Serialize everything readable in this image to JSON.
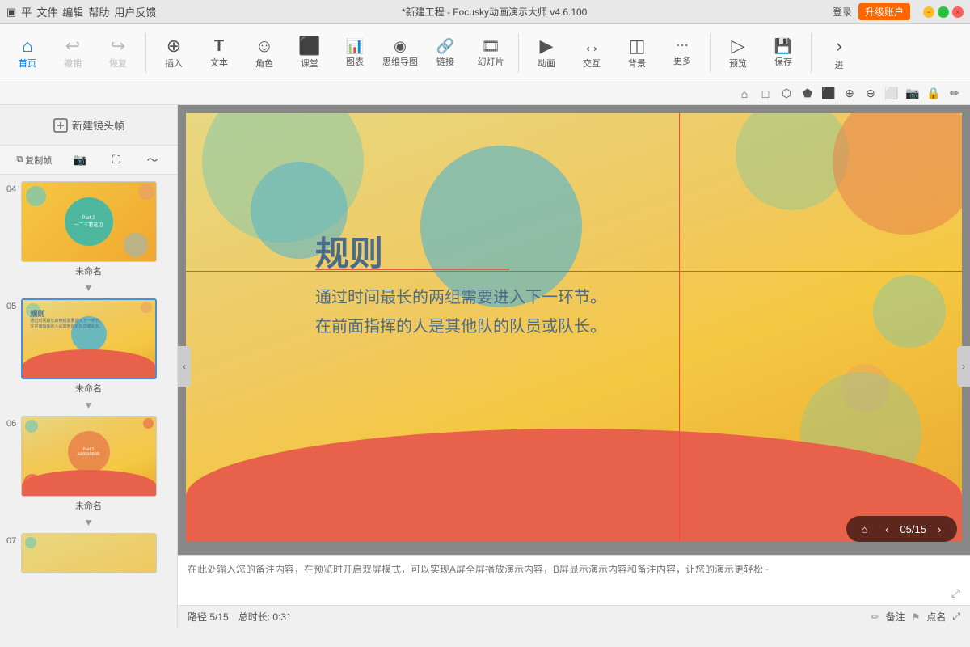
{
  "titlebar": {
    "app_icon": "▣",
    "menu_items": [
      "平",
      "文件",
      "编辑",
      "帮助",
      "用户反馈"
    ],
    "title": "*新建工程 - Focusky动画演示大师  v4.6.100",
    "login_label": "登录",
    "upgrade_label": "升级账户"
  },
  "toolbar": {
    "items": [
      {
        "id": "home",
        "icon": "⌂",
        "label": "首页"
      },
      {
        "id": "undo",
        "icon": "↩",
        "label": "撤销"
      },
      {
        "id": "redo",
        "icon": "↪",
        "label": "恢复"
      },
      {
        "id": "insert",
        "icon": "⊕",
        "label": "插入"
      },
      {
        "id": "text",
        "icon": "T",
        "label": "文本"
      },
      {
        "id": "role",
        "icon": "☺",
        "label": "角色"
      },
      {
        "id": "class",
        "icon": "⬛",
        "label": "课堂"
      },
      {
        "id": "chart",
        "icon": "📊",
        "label": "图表"
      },
      {
        "id": "mindmap",
        "icon": "◉",
        "label": "思维导图"
      },
      {
        "id": "link",
        "icon": "🔗",
        "label": "链接"
      },
      {
        "id": "slide",
        "icon": "▭",
        "label": "幻灯片"
      },
      {
        "id": "animate",
        "icon": "▶",
        "label": "动画"
      },
      {
        "id": "interact",
        "icon": "↔",
        "label": "交互"
      },
      {
        "id": "bg",
        "icon": "◫",
        "label": "背景"
      },
      {
        "id": "more",
        "icon": "⋯",
        "label": "更多"
      },
      {
        "id": "preview",
        "icon": "▷",
        "label": "预览"
      },
      {
        "id": "save",
        "icon": "💾",
        "label": "保存"
      },
      {
        "id": "forward",
        "icon": "›",
        "label": "进"
      }
    ]
  },
  "subtoolbar": {
    "tools": [
      "⌂",
      "□",
      "⬡",
      "⬟",
      "⬛",
      "⊕",
      "⊖",
      "⬜",
      "📷",
      "⬟",
      "✏"
    ]
  },
  "left_panel": {
    "add_frame_label": "新建镜头帧",
    "controls": [
      "复制帧",
      "📷",
      "⛶",
      "~"
    ],
    "slides": [
      {
        "number": "04",
        "name": "未命名",
        "active": false
      },
      {
        "number": "05",
        "name": "未命名",
        "active": true
      },
      {
        "number": "06",
        "name": "未命名",
        "active": false
      },
      {
        "number": "07",
        "name": "",
        "active": false
      }
    ]
  },
  "canvas": {
    "slide_title": "规则",
    "slide_body_line1": "通过时间最长的两组需要进入下一环节。",
    "slide_body_line2": "在前面指挥的人是其他队的队员或队长。",
    "nav_page": "05/15",
    "nav_prev": "‹",
    "nav_next": "›",
    "nav_home": "⌂"
  },
  "notes": {
    "placeholder": "在此处输入您的备注内容，在预览时开启双屏模式，可以实现A屏全屏播放演示内容，B屏显示演示内容和备注内容，让您的演示更轻松~"
  },
  "statusbar": {
    "path": "路径 5/15",
    "duration": "总时长: 0:31",
    "notes_btn": "备注",
    "bookmark_btn": "点名"
  }
}
